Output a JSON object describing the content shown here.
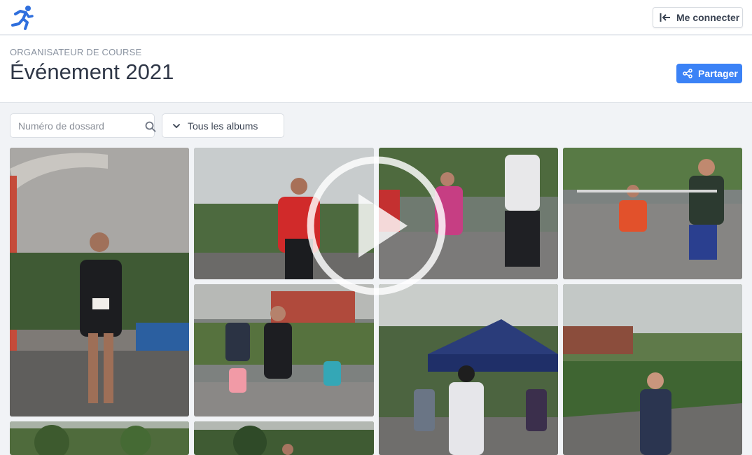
{
  "topbar": {
    "logo_icon": "runner-icon",
    "login_label": "Me connecter",
    "login_icon": "sign-in-icon"
  },
  "header": {
    "eyebrow": "ORGANISATEUR DE COURSE",
    "title": "Événement 2021",
    "share_label": "Partager",
    "share_icon": "share-icon"
  },
  "filters": {
    "search_placeholder": "Numéro de dossard",
    "search_icon": "search-icon",
    "album_label": "Tous les albums",
    "album_icon": "chevron-down-icon"
  },
  "gallery": {
    "video_icon": "play-icon",
    "photos": [
      "runner-finish-arch-photo",
      "runner-red-jersey-photo",
      "children-running-photo",
      "child-orange-shirt-photo",
      "family-running-photo",
      "cyclist-tent-photo",
      "woman-runner-photo",
      "trees-photo",
      "forest-runner-photo"
    ]
  },
  "colors": {
    "accent": "#3b82f6",
    "logo": "#2f6fdd"
  }
}
